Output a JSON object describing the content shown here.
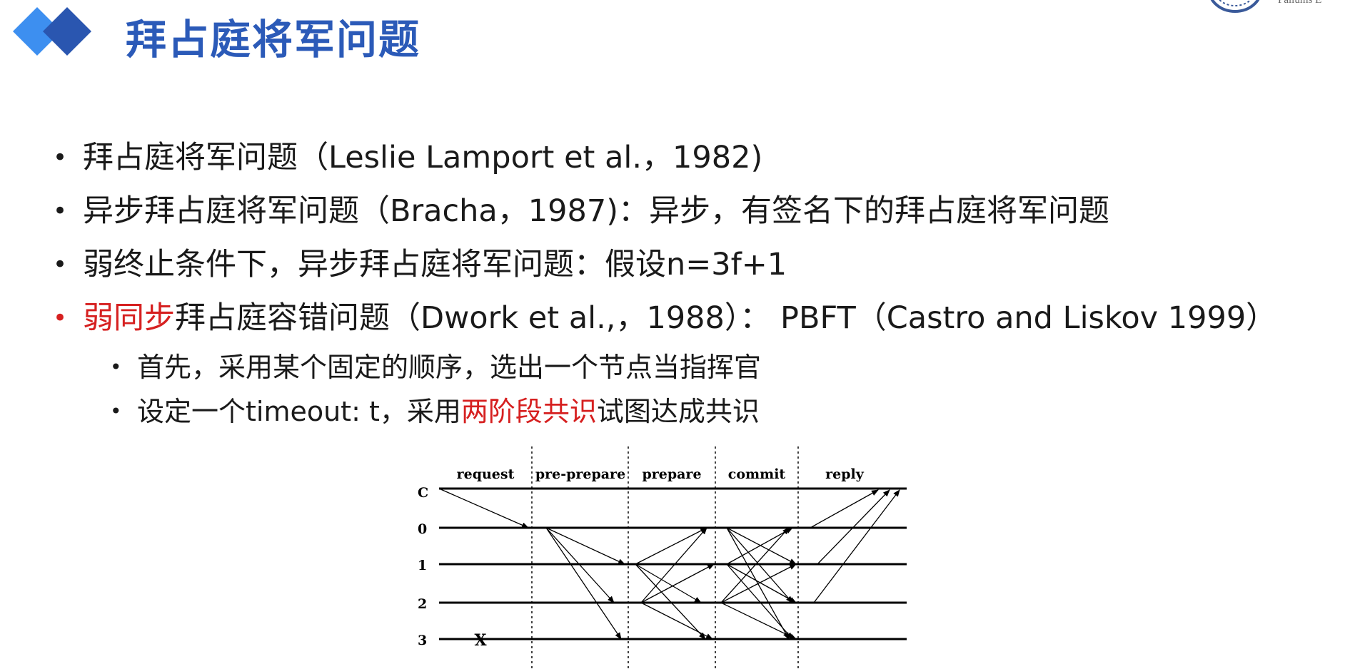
{
  "header": {
    "title": "拜占庭将军问题",
    "corner_text": "Pallums E"
  },
  "bullets": [
    {
      "segments": [
        {
          "text": "拜占庭将军问题（Leslie Lamport et al.，1982)",
          "color": "normal"
        }
      ]
    },
    {
      "segments": [
        {
          "text": "异步拜占庭将军问题（Bracha，1987)：异步，有签名下的拜占庭将军问题",
          "color": "normal"
        }
      ]
    },
    {
      "segments": [
        {
          "text": "弱终止条件下，异步拜占庭将军问题：假设n=3f+1",
          "color": "normal"
        }
      ]
    },
    {
      "color": "red",
      "segments": [
        {
          "text": "弱同步",
          "color": "red"
        },
        {
          "text": "拜占庭容错问题（Dwork et al.,，1988）：  PBFT（Castro and Liskov 1999）",
          "color": "normal"
        }
      ],
      "sub": [
        {
          "segments": [
            {
              "text": "首先，采用某个固定的顺序，选出一个节点当指挥官",
              "color": "normal"
            }
          ]
        },
        {
          "segments": [
            {
              "text": "设定一个timeout: t，采用",
              "color": "normal"
            },
            {
              "text": "两阶段共识",
              "color": "red"
            },
            {
              "text": "试图达成共识",
              "color": "normal"
            }
          ]
        }
      ]
    }
  ],
  "diagram": {
    "phases": [
      "request",
      "pre-prepare",
      "prepare",
      "commit",
      "reply"
    ],
    "nodes": [
      "C",
      "0",
      "1",
      "2",
      "3"
    ],
    "fault_mark": "X",
    "colors": {
      "title": "#2b5ab8",
      "red": "#d62020",
      "lines": "#000000"
    }
  }
}
